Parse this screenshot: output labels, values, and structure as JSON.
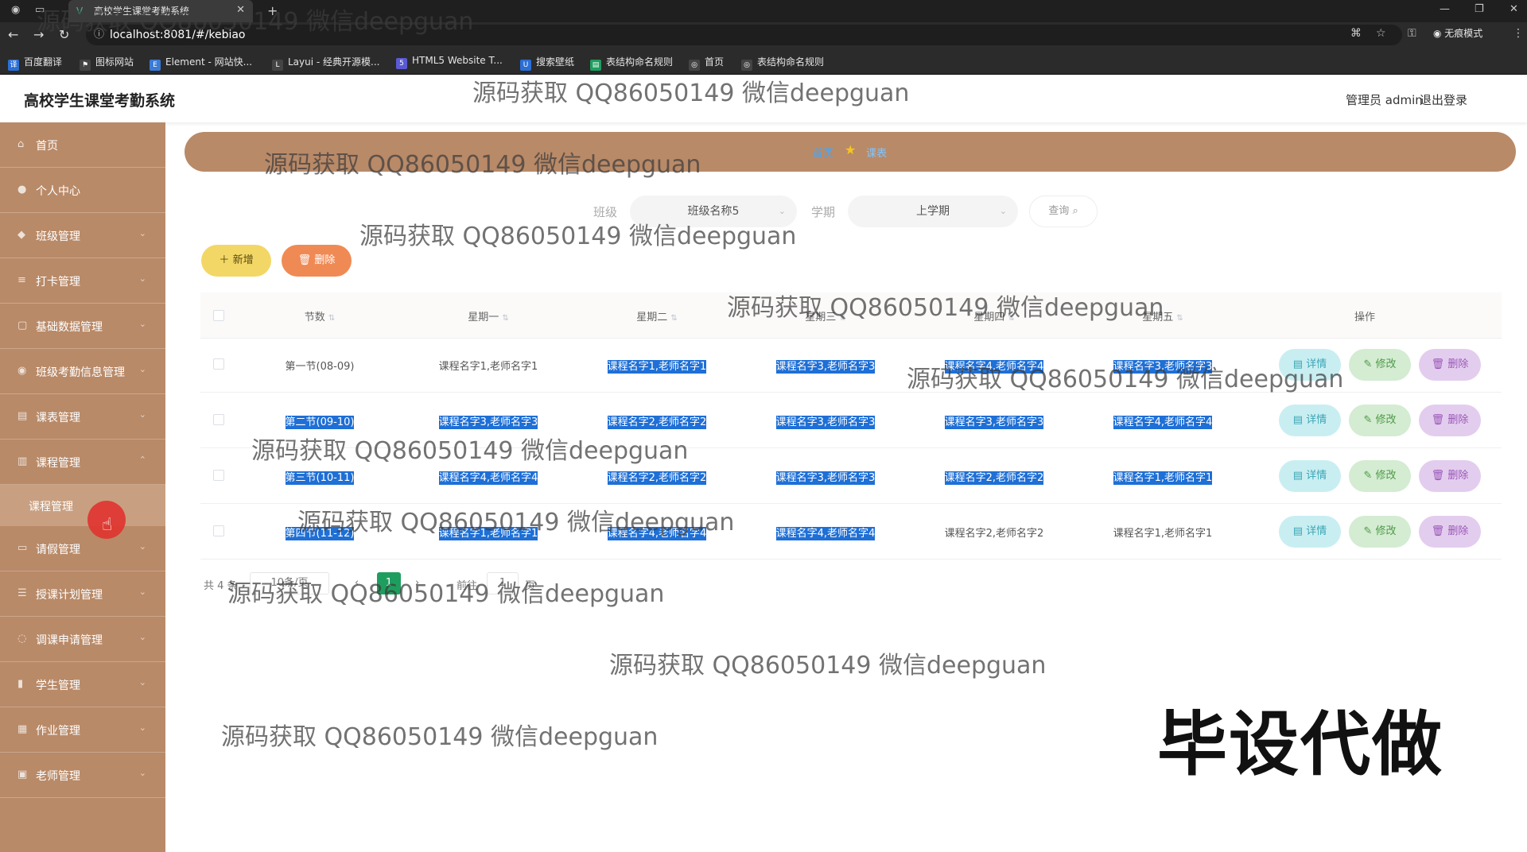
{
  "browser": {
    "tab_title": "高校学生课堂考勤系统",
    "url": "localhost:8081/#/kebiao",
    "incognito_label": "无痕模式",
    "bookmarks": [
      {
        "label": "百度翻译",
        "color": "#2b6fd6"
      },
      {
        "label": "图标网站",
        "color": "#444444"
      },
      {
        "label": "Element - 网站快...",
        "color": "#3a7bd5"
      },
      {
        "label": "Layui - 经典开源模...",
        "color": "#444444"
      },
      {
        "label": "HTML5 Website T...",
        "color": "#5a5ad6"
      },
      {
        "label": "搜索壁纸",
        "color": "#2b6fd6"
      },
      {
        "label": "表结构命名规则",
        "color": "#1e9e5e"
      },
      {
        "label": "首页",
        "color": "#444444"
      },
      {
        "label": "表结构命名规则",
        "color": "#444444"
      }
    ]
  },
  "header": {
    "title": "高校学生课堂考勤系统",
    "user": "管理员 admin",
    "logout": "退出登录"
  },
  "sidebar": {
    "items": [
      {
        "label": "首页",
        "icon": "home-icon"
      },
      {
        "label": "个人中心",
        "icon": "user-icon"
      },
      {
        "label": "班级管理",
        "icon": "class-icon"
      },
      {
        "label": "打卡管理",
        "icon": "list-icon"
      },
      {
        "label": "基础数据管理",
        "icon": "data-icon"
      },
      {
        "label": "班级考勤信息管理",
        "icon": "attendance-icon"
      },
      {
        "label": "课表管理",
        "icon": "table-icon"
      },
      {
        "label": "课程管理",
        "icon": "course-icon"
      },
      {
        "label": "请假管理",
        "icon": "leave-icon"
      },
      {
        "label": "授课计划管理",
        "icon": "plan-icon"
      },
      {
        "label": "调课申请管理",
        "icon": "swap-icon"
      },
      {
        "label": "学生管理",
        "icon": "student-icon"
      },
      {
        "label": "作业管理",
        "icon": "homework-icon"
      },
      {
        "label": "老师管理",
        "icon": "teacher-icon"
      }
    ],
    "active_sub": "课程管理"
  },
  "breadcrumb": {
    "home": "首页",
    "current": "课表"
  },
  "search": {
    "class_label": "班级",
    "class_value": "班级名称5",
    "term_label": "学期",
    "term_value": "上学期",
    "query_button": "查询"
  },
  "actions": {
    "add": "新增",
    "delete": "删除"
  },
  "table": {
    "headers": [
      "节数",
      "星期一",
      "星期二",
      "星期三",
      "星期四",
      "星期五",
      "操作"
    ],
    "rows": [
      {
        "section": "第一节(08-09)",
        "mon": "课程名字1,老师名字1",
        "tue": "课程名字1,老师名字1",
        "wed": "课程名字3,老师名字3",
        "thu": "课程名字4,老师名字4",
        "fri": "课程名字3,老师名字3"
      },
      {
        "section": "第二节(09-10)",
        "mon": "课程名字3,老师名字3",
        "tue": "课程名字2,老师名字2",
        "wed": "课程名字3,老师名字3",
        "thu": "课程名字3,老师名字3",
        "fri": "课程名字4,老师名字4"
      },
      {
        "section": "第三节(10-11)",
        "mon": "课程名字4,老师名字4",
        "tue": "课程名字2,老师名字2",
        "wed": "课程名字3,老师名字3",
        "thu": "课程名字2,老师名字2",
        "fri": "课程名字1,老师名字1"
      },
      {
        "section": "第四节(11-12)",
        "mon": "课程名字1,老师名字1",
        "tue": "课程名字4,老师名字4",
        "wed": "课程名字4,老师名字4",
        "thu": "课程名字2,老师名字2",
        "fri": "课程名字1,老师名字1"
      }
    ],
    "op_detail": "详情",
    "op_edit": "修改",
    "op_delete": "删除"
  },
  "pager": {
    "total": "共 4 条",
    "size": "10条/页",
    "page": "1",
    "goto_label": "前往",
    "goto_value": "1",
    "goto_unit": "页"
  },
  "watermark": {
    "text": "源码获取 QQ86050149 微信deepguan",
    "big": "毕设代做"
  }
}
